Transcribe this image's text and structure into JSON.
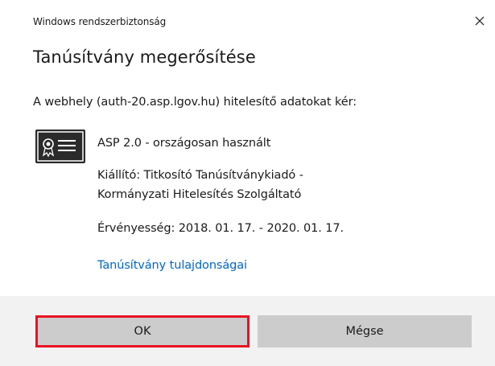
{
  "dialog": {
    "caption": "Windows rendszerbiztonság",
    "title": "Tanúsítvány megerősítése",
    "intro": "A webhely (auth-20.asp.lgov.hu) hitelesítő adatokat kér:",
    "certificate": {
      "icon": "certificate-icon",
      "name": "ASP 2.0 - országosan használt",
      "issuer_line1": "Kiállító: Titkosító Tanúsítványkiadó -",
      "issuer_line2": "Kormányzati Hitelesítés Szolgáltató",
      "validity": "Érvényesség: 2018. 01. 17. - 2020. 01. 17.",
      "properties_link": "Tanúsítvány tulajdonságai"
    },
    "buttons": {
      "ok": "OK",
      "cancel": "Mégse"
    },
    "close_icon": "close-icon"
  },
  "colors": {
    "link": "#0066cc",
    "button_bg": "#cccccc",
    "footer_bg": "#f2f2f2",
    "highlight": "#e81123"
  }
}
